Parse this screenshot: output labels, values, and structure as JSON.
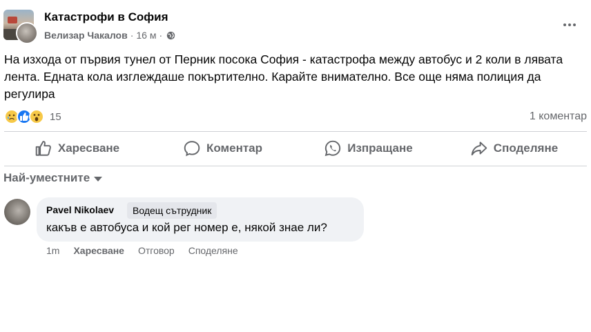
{
  "post": {
    "group_name": "Катастрофи в София",
    "author": "Велизар Чакалов",
    "separator": "·",
    "time": "16 м",
    "text": "На изхода от първия тунел от Перник посока София - катастрофа между автобус и 2 коли в лявата лента. Едната кола изглеждаше покъртително. Карайте внимателно. Все още няма полиция да регулира",
    "reaction_count": "15",
    "comment_count": "1 коментар"
  },
  "actions": {
    "like": "Харесване",
    "comment": "Коментар",
    "send": "Изпращане",
    "share": "Споделяне"
  },
  "comments": {
    "sort_label": "Най-уместните",
    "items": [
      {
        "name": "Pavel Nikolaev",
        "badge": "Водещ сътрудник",
        "text": "какъв е автобуса и кой рег номер е, някой знае ли?",
        "time": "1m",
        "like": "Харесване",
        "reply": "Отговор",
        "share": "Споделяне"
      }
    ]
  },
  "icons": [
    "globe-icon",
    "more-icon",
    "sad-reaction-icon",
    "like-reaction-icon",
    "wow-reaction-icon",
    "like-icon",
    "comment-icon",
    "whatsapp-icon",
    "share-icon",
    "caret-down-icon"
  ],
  "colors": {
    "text": "#050505",
    "secondary": "#65676b",
    "bubble": "#f0f2f5",
    "like_blue": "#1877f2"
  }
}
